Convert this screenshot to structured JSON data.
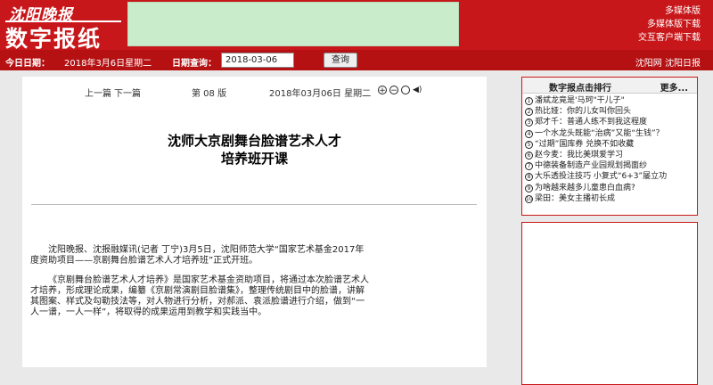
{
  "header": {
    "logo_line1": "沈阳晚报",
    "logo_line2": "数字报纸",
    "links": [
      "多媒体版",
      "多媒体版下载",
      "交互客户端下载"
    ]
  },
  "datebar": {
    "today_label": "今日日期：",
    "today_value": "2018年3月6日星期二",
    "query_label": "日期查询：",
    "query_value": "2018-03-06",
    "query_button": "查询",
    "site_links": "沈阳网  沈阳日报"
  },
  "article": {
    "prev": "上一篇",
    "next": "下一篇",
    "page": "第 08 版",
    "date": "2018年03月06日 星期二",
    "title_line1": "沈师大京剧舞台脸谱艺术人才",
    "title_line2": "培养班开课",
    "paragraphs": [
      "沈阳晚报、沈报融媒讯(记者 丁宁)3月5日，沈阳师范大学“国家艺术基金2017年度资助项目——京剧舞台脸谱艺术人才培养班”正式开班。",
      "《京剧舞台脸谱艺术人才培养》是国家艺术基金资助项目，将通过本次脸谱艺术人才培养，形成理论成果，编纂《京剧常演剧目脸谱集》，整理传统剧目中的脸谱，讲解其图案、样式及勾勒技法等，对人物进行分析，对郝派、袁派脸谱进行介绍，做到“一人一谱，一人一样”，将取得的成果运用到教学和实践当中。"
    ]
  },
  "ranking": {
    "title": "数字报点击排行",
    "more": "更多...",
    "items": [
      {
        "num": "1",
        "text": "潘斌龙竟是'马珂\"干儿子\""
      },
      {
        "num": "2",
        "text": "热比娅：你的儿女叫你回头"
      },
      {
        "num": "3",
        "text": "郑才千：普通人练不到我这程度"
      },
      {
        "num": "4",
        "text": "一个水龙头既能“治病”又能“生钱”？"
      },
      {
        "num": "5",
        "text": "“过期”国库券 兑换不如收藏"
      },
      {
        "num": "6",
        "text": "赵今麦：我比美琪爱学习"
      },
      {
        "num": "7",
        "text": "中德装备制造产业园规划揭面纱"
      },
      {
        "num": "8",
        "text": "大乐透投注技巧 小复式“6+3”屡立功"
      },
      {
        "num": "9",
        "text": "为啥越来越多儿童患白血病?"
      },
      {
        "num": "10",
        "text": "梁田：美女主播初长成"
      }
    ]
  }
}
